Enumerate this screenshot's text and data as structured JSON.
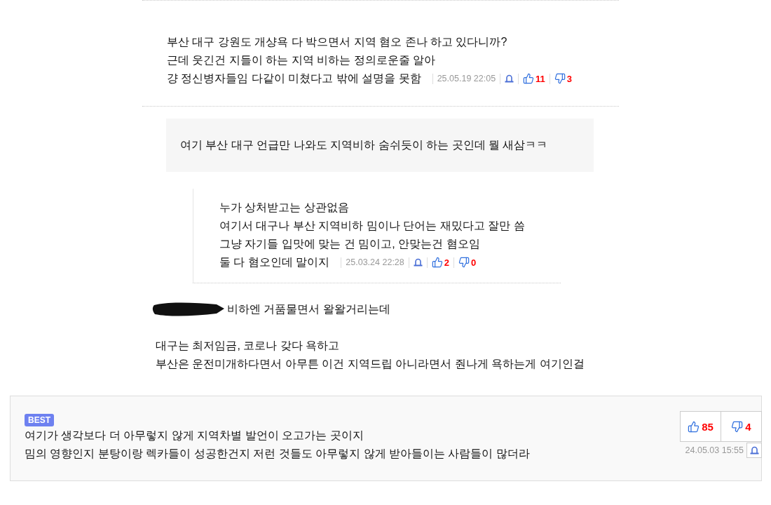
{
  "comment": {
    "lines": [
      "부산 대구 강원도 개샹욕 다 박으면서 지역 혐오 존나 하고 있다니까?",
      "근데 웃긴건 지들이 하는 지역 비하는 정의로운줄 알아",
      "걍 정신병자들임 다같이 미쳤다고 밖에 설명을 못함"
    ],
    "date": "25.05.19 22:05",
    "likes": "11",
    "dislikes": "3"
  },
  "quote": {
    "text": "여기 부산 대구 언급만 나와도 지역비하 숨쉬듯이 하는 곳인데 뭘 새삼ㅋㅋ"
  },
  "reply": {
    "lines": [
      "누가 상처받고는 상관없음",
      "여기서 대구나 부산 지역비하 밈이나 단어는 재밌다고 잘만 씀",
      "그냥 자기들 입맛에 맞는 건 밈이고, 안맞는건 혐오임",
      "둘 다 혐오인데 말이지"
    ],
    "date": "25.03.24 22:28",
    "likes": "2",
    "dislikes": "0"
  },
  "body": {
    "redacted": true,
    "lines": [
      "비하엔 거품물면서 왈왈거리는데",
      "대구는 최저임금, 코로나 갖다 욕하고",
      "부산은 운전미개하다면서 아무튼 이건 지역드립 아니라면서 줜나게 욕하는게 여기인걸"
    ]
  },
  "best_comment": {
    "badge": "BEST",
    "lines": [
      "여기가 생각보다 더 아무렇지 않게 지역차별 발언이 오고가는 곳이지",
      "밈의 영향인지 분탕이랑 렉카들이 성공한건지 저런 것들도 아무렇지 않게 받아들이는 사람들이 많더라"
    ],
    "likes": "85",
    "dislikes": "4",
    "date": "24.05.03 15:55"
  }
}
